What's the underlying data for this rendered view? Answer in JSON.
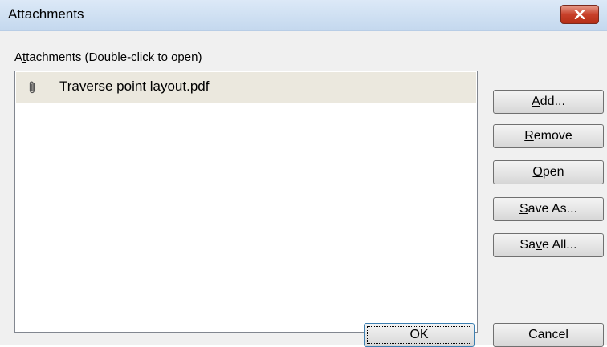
{
  "window": {
    "title": "Attachments",
    "close_icon": "close-icon"
  },
  "list_label": {
    "before": "A",
    "accel": "t",
    "after": "tachments (Double-click to open)"
  },
  "attachments": [
    {
      "icon": "paperclip-icon",
      "name": "Traverse point layout.pdf",
      "selected": true
    }
  ],
  "buttons": {
    "add": {
      "before": "",
      "accel": "A",
      "after": "dd..."
    },
    "remove": {
      "before": "",
      "accel": "R",
      "after": "emove"
    },
    "open": {
      "before": "",
      "accel": "O",
      "after": "pen"
    },
    "save_as": {
      "before": "",
      "accel": "S",
      "after": "ave As..."
    },
    "save_all": {
      "before": "Sa",
      "accel": "v",
      "after": "e All..."
    },
    "ok": "OK",
    "cancel": "Cancel"
  },
  "colors": {
    "selected_row": "#ebe8de",
    "close_button": "#c8402a"
  }
}
